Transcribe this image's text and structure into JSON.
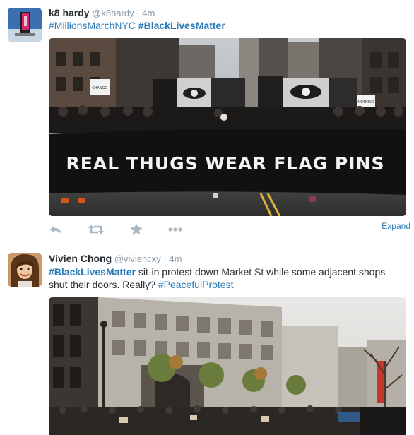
{
  "tweets": [
    {
      "fullname": "k8 hardy",
      "username": "@k8hardy",
      "dot": "·",
      "time": "4m",
      "hashtags": [
        "#MillionsMarchNYC",
        "#BlackLivesMatter"
      ],
      "media": {
        "banner_text": "REAL THUGS WEAR  FLAG PINS",
        "sign_left": "CHANGE",
        "sign_right": "NOTHING"
      },
      "actions": [
        "reply-icon",
        "retweet-icon",
        "favorite-icon",
        "more-icon"
      ],
      "expand_label": "Expand"
    },
    {
      "fullname": "Vivien Chong",
      "username": "@viviencxy",
      "dot": "·",
      "time": "4m",
      "hashtag_start": "#BlackLivesMatter",
      "text_middle": " sit-in protest down Market St while some adjacent shops shut their doors. Really? ",
      "hashtag_end": "#PeacefulProtest"
    }
  ],
  "colors": {
    "link": "#2b7bb9",
    "secondary": "#8899a6",
    "text": "#292f33",
    "divider": "#e1e8ed",
    "icon": "#aab8c2"
  }
}
